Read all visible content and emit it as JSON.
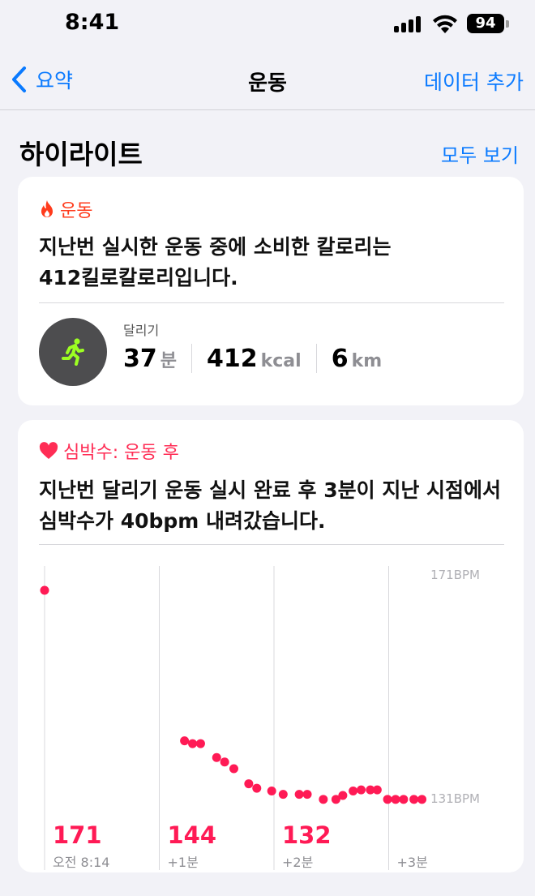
{
  "status_bar": {
    "time": "8:41",
    "battery": "94"
  },
  "nav": {
    "back_label": "요약",
    "title": "운동",
    "action_label": "데이터 추가"
  },
  "highlights": {
    "title": "하이라이트",
    "see_all": "모두 보기"
  },
  "workout_card": {
    "category": "운동",
    "text_line1": "지난번 실시한 운동 중에 소비한 칼로리는",
    "text_line2": "412킬로칼로리입니다.",
    "workout_type": "달리기",
    "duration_value": "37",
    "duration_unit": "분",
    "calories_value": "412",
    "calories_unit": "kcal",
    "distance_value": "6",
    "distance_unit": "km",
    "accent_color": "#ff3b1c",
    "icon": "running-figure-icon"
  },
  "heart_card": {
    "category": "심박수: 운동 후",
    "text_line1": "지난번 달리기 운동 실시 완료 후 3분이 지난 시점에서",
    "text_line2": "심박수가 40bpm 내려갔습니다.",
    "accent_color": "#ff2d55",
    "icon": "heart-icon"
  },
  "chart_data": {
    "type": "scatter",
    "y_max_label": "171BPM",
    "y_min_label": "131BPM",
    "ylim": [
      131,
      171
    ],
    "x_tick_labels": [
      "오전 8:14",
      "+1분",
      "+2분",
      "+3분"
    ],
    "value_labels": [
      "171",
      "144",
      "132"
    ],
    "series": [
      {
        "points": [
          [
            0,
            171
          ],
          [
            1.22,
            144
          ],
          [
            1.29,
            143.5
          ],
          [
            1.36,
            143.5
          ],
          [
            1.5,
            141
          ],
          [
            1.57,
            140.2
          ],
          [
            1.65,
            139
          ],
          [
            1.78,
            136.3
          ],
          [
            1.85,
            135.5
          ],
          [
            1.98,
            135
          ],
          [
            2.08,
            134.4
          ],
          [
            2.22,
            134.4
          ],
          [
            2.29,
            134.4
          ],
          [
            2.43,
            133.5
          ],
          [
            2.54,
            133.5
          ],
          [
            2.6,
            134.2
          ],
          [
            2.69,
            135
          ],
          [
            2.76,
            135.2
          ],
          [
            2.84,
            135.2
          ],
          [
            2.9,
            135.2
          ],
          [
            2.99,
            133.5
          ],
          [
            3.06,
            133.5
          ],
          [
            3.13,
            133.5
          ],
          [
            3.22,
            133.5
          ],
          [
            3.29,
            133.5
          ]
        ]
      }
    ]
  }
}
